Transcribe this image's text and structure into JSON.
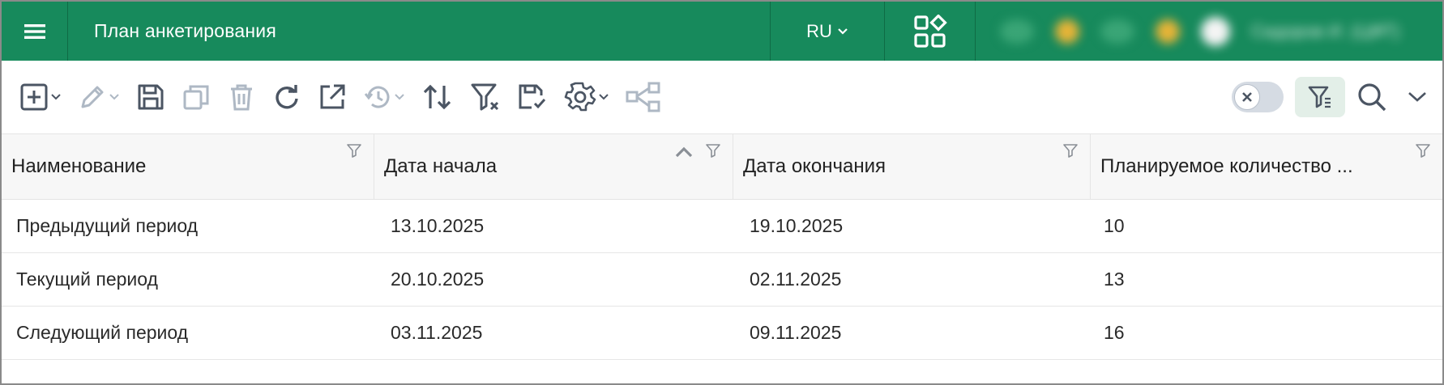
{
  "header": {
    "title": "План анкетирования",
    "language": "RU",
    "user_name": "Сидоров И. (ЦФТ)",
    "menu_icon": "hamburger-icon",
    "apps_icon": "apps-grid-icon"
  },
  "toolbar": {
    "buttons": [
      "add-icon",
      "edit-icon",
      "save-icon",
      "copy-icon",
      "delete-icon",
      "refresh-icon",
      "open-external-icon",
      "history-icon",
      "sort-icon",
      "clear-filter-icon",
      "save-filter-icon",
      "settings-icon",
      "hierarchy-icon"
    ],
    "right": [
      "clear-toggle",
      "filter-settings-icon",
      "search-icon",
      "chevron-down-icon"
    ]
  },
  "table": {
    "columns": [
      "Наименование",
      "Дата начала",
      "Дата окончания",
      "Планируемое количество ..."
    ],
    "rows": [
      [
        "Предыдущий период",
        "13.10.2025",
        "19.10.2025",
        "10"
      ],
      [
        "Текущий период",
        "20.10.2025",
        "02.11.2025",
        "13"
      ],
      [
        "Следующий период",
        "03.11.2025",
        "09.11.2025",
        "16"
      ]
    ]
  },
  "colors": {
    "header_bg": "#178a5c",
    "icon_active": "#4b5563",
    "icon_disabled": "#aeb8c4"
  }
}
